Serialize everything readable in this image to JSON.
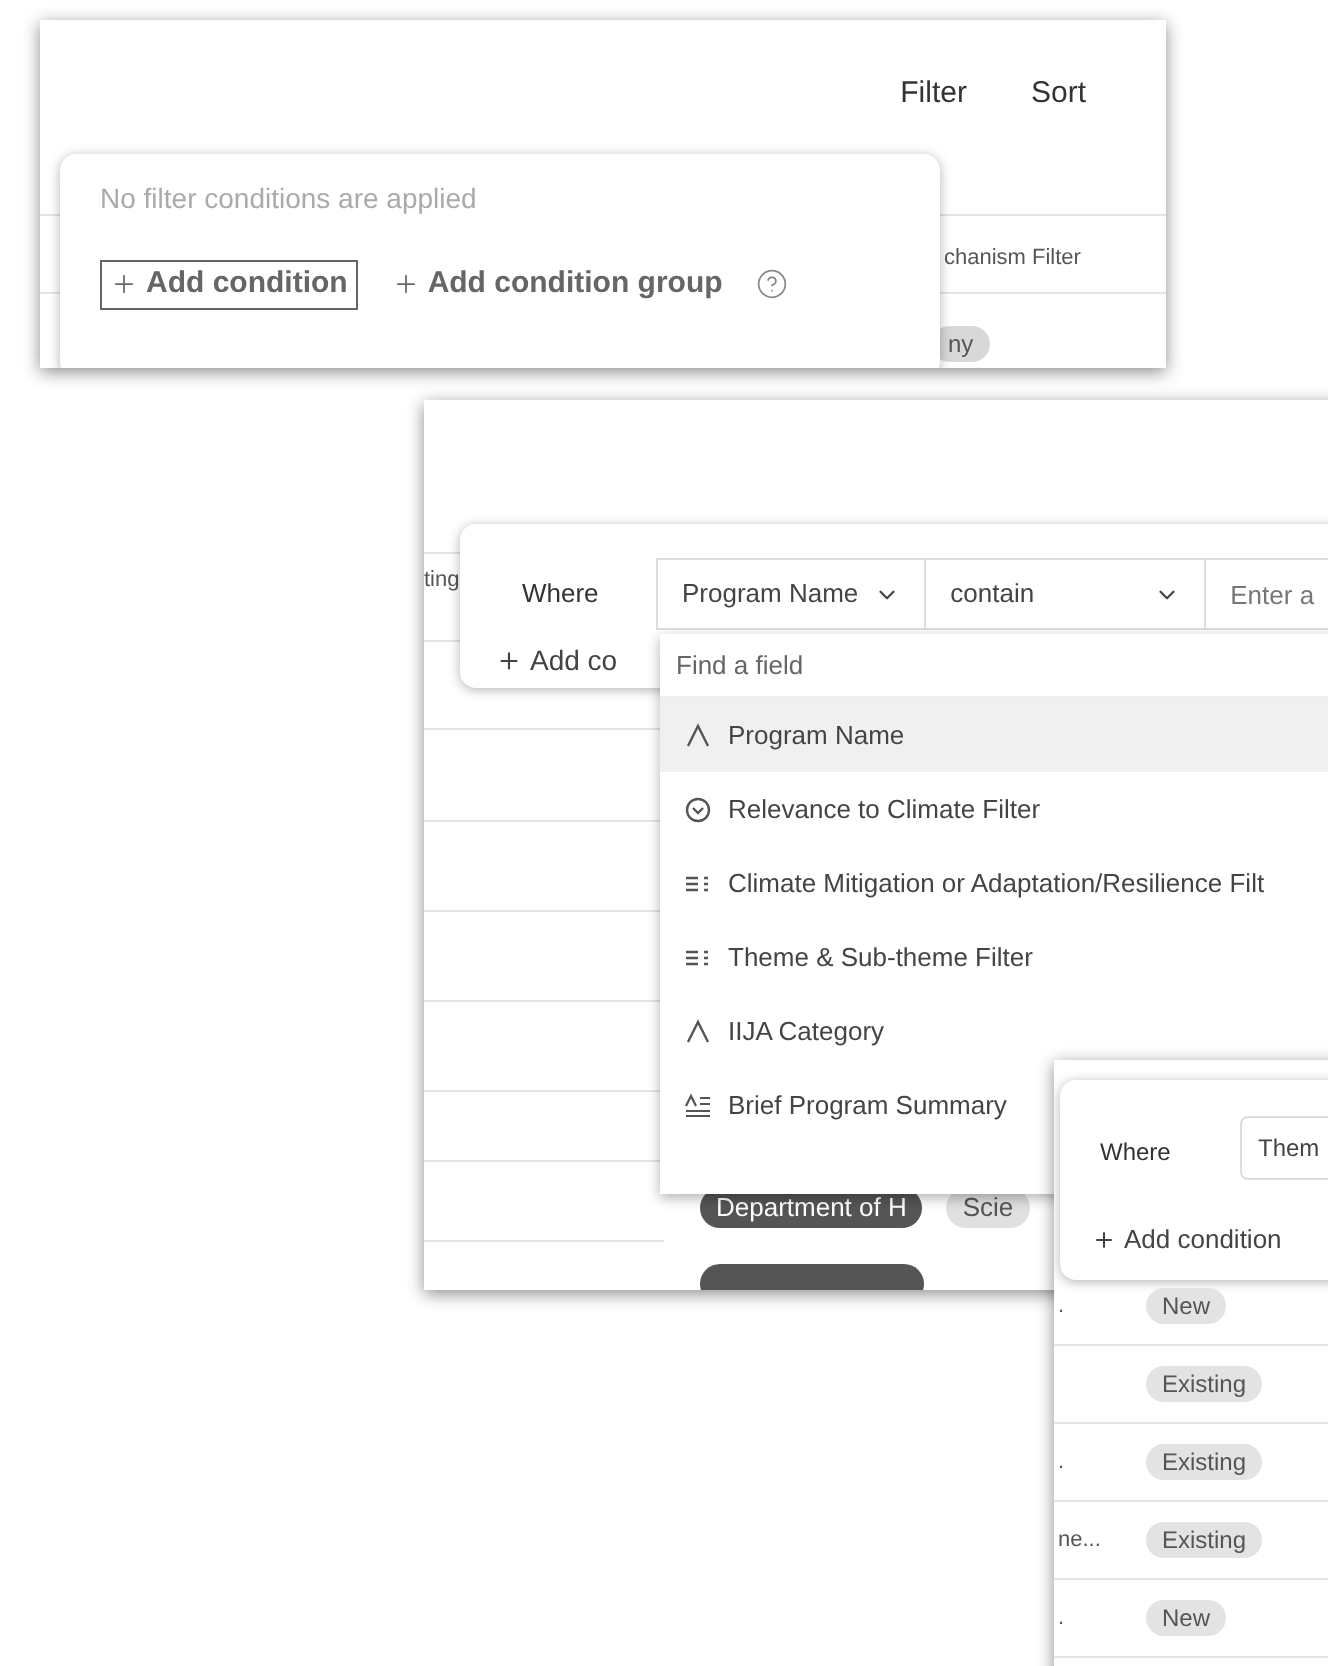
{
  "shot_1": {
    "toolbar": [
      {
        "label": "Filter"
      },
      {
        "label": "Sort"
      }
    ],
    "column_header": "chanism Filter",
    "tag": "ny",
    "message": "No filter conditions are applied",
    "actions": [
      {
        "label": "Add condition",
        "focused": true
      },
      {
        "label": "Add condition group",
        "focused": false
      }
    ]
  },
  "shot_2": {
    "column_header": "ting",
    "where": "Where",
    "field": "Program Name",
    "operator": "contain",
    "value_placeholder": "Enter a",
    "add_label": "Add co",
    "search_placeholder": "Find a field",
    "fields": [
      {
        "label": "Program Name",
        "kind": "text",
        "selected": true
      },
      {
        "label": "Relevance to Climate Filter",
        "kind": "single_select",
        "selected": false
      },
      {
        "label": "Climate Mitigation or Adaptation/Resilience Filt",
        "kind": "multi_select",
        "selected": false
      },
      {
        "label": "Theme & Sub-theme Filter",
        "kind": "multi_select",
        "selected": false
      },
      {
        "label": "IIJA Category",
        "kind": "text",
        "selected": false
      },
      {
        "label": "Brief Program Summary",
        "kind": "long_text",
        "selected": false
      }
    ],
    "rows": [
      {
        "agency": "Department of H",
        "tag": "Scie"
      }
    ]
  },
  "shot_3": {
    "where": "Where",
    "field": "Them",
    "add_label": "Add condition",
    "rows": [
      {
        "cell": ".",
        "status": "New"
      },
      {
        "status": "Existing"
      },
      {
        "cell": ".",
        "status": "Existing"
      },
      {
        "cell": "ne...",
        "status": "Existing"
      },
      {
        "cell": ".",
        "status": "New"
      }
    ]
  }
}
